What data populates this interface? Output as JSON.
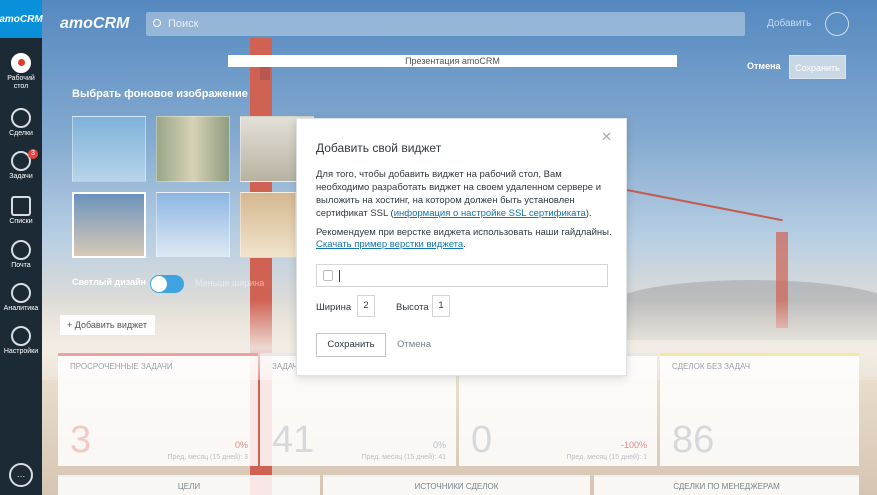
{
  "sidebar": {
    "logo": "amoCRM",
    "items": [
      {
        "label": "Рабочий стол",
        "icon": "dashboard-icon"
      },
      {
        "label": "Сделки",
        "icon": "dollar-icon"
      },
      {
        "label": "Задачи",
        "icon": "check-icon",
        "badge": "3"
      },
      {
        "label": "Списки",
        "icon": "list-icon"
      },
      {
        "label": "Почта",
        "icon": "mail-icon"
      },
      {
        "label": "Аналитика",
        "icon": "chart-icon"
      },
      {
        "label": "Настройки",
        "icon": "gear-icon"
      }
    ]
  },
  "header": {
    "brand": "amoCRM",
    "search_placeholder": "Поиск",
    "add_label": "Добавить"
  },
  "editor": {
    "presentation": "Презентация amoCRM",
    "cancel_label": "Отмена",
    "save_label": "Сохранить",
    "bg_title": "Выбрать фоновое изображение",
    "light_label": "Светлый дизайн",
    "wide_label": "Меньше ширина",
    "add_widget_label": "+ Добавить виджет"
  },
  "widgets": [
    {
      "title": "Просроченные задачи",
      "value": "3",
      "pct": "0%",
      "sub": "Пред. месяц (15 дней): 3"
    },
    {
      "title": "Задачи",
      "value": "41",
      "pct": "0%",
      "sub": "Пред. месяц (15 дней): 41"
    },
    {
      "title": "",
      "value": "0",
      "pct": "-100%",
      "sub": "Пред. месяц (15 дней): 1"
    },
    {
      "title": "Сделок без задач",
      "value": "86",
      "pct": "",
      "sub": ""
    }
  ],
  "widgets_row2": [
    "Цели",
    "Источники сделок",
    "Сделки по менеджерам"
  ],
  "modal": {
    "title": "Добавить свой виджет",
    "p1_text": "Для того, чтобы добавить виджет на рабочий стол, Вам необходимо разработать виджет на своем удаленном сервере и выложить на хостинг, на котором должен быть установлен сертификат SSL (",
    "p1_link": "информация о настройке SSL сертификата",
    "p1_end": ").",
    "p2_text": "Рекомендуем при верстке виджета использовать наши гайдлайны.",
    "p2_link": "Скачать пример верстки виджета",
    "p2_end": ".",
    "url_value": "",
    "width_label": "Ширина",
    "width_value": "2",
    "height_label": "Высота",
    "height_value": "1",
    "save_label": "Сохранить",
    "cancel_label": "Отмена"
  },
  "colors": {
    "accent": "#0a8fd9",
    "sidebar": "#1c2a36",
    "link": "#1375ab"
  }
}
